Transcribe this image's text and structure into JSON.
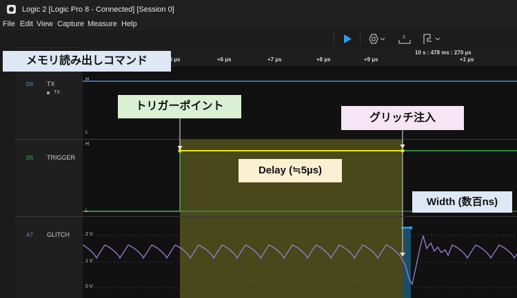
{
  "window": {
    "title": "Logic 2 [Logic Pro 8 - Connected] [Session 0]"
  },
  "menu": [
    "File",
    "Edit",
    "View",
    "Capture",
    "Measure",
    "Help"
  ],
  "toolbar": {
    "step_icon": "3"
  },
  "ruler": {
    "ticks": [
      "+5 µs",
      "+6 µs",
      "+7 µs",
      "+8 µs",
      "+9 µs",
      "+1 µs"
    ],
    "timestamp": "10 s : 478 ms : 270 µs"
  },
  "channels": {
    "d6": {
      "id": "D6",
      "name": "TX",
      "sub": "TX",
      "high": "H",
      "low": "L",
      "color": "#4a90d9"
    },
    "d5": {
      "id": "D5",
      "name": "TRIGGER",
      "high": "H",
      "low": "L",
      "color": "#3db85a"
    },
    "a7": {
      "id": "A7",
      "name": "GLITCH",
      "v2": "2 V",
      "v1": "1 V",
      "v0": "0 V",
      "color": "#9b7fd4"
    }
  },
  "annotations": {
    "memory_read": "メモリ読み出しコマンド",
    "trigger_point": "トリガーポイント",
    "glitch_inject": "グリッチ注入",
    "delay": "Delay (≒5µs)",
    "width": "Width (数百ns)"
  },
  "colors": {
    "trigger_line": "#e8e800",
    "delay_region": "#48481a",
    "glitch_bar": "#1e4e66",
    "callout_green": "#d9f0d3",
    "callout_pink": "#f6e6f3",
    "callout_yellow": "#fbf0d2",
    "callout_blue": "#dde8f4",
    "width_marker": "#2ea8e0"
  }
}
